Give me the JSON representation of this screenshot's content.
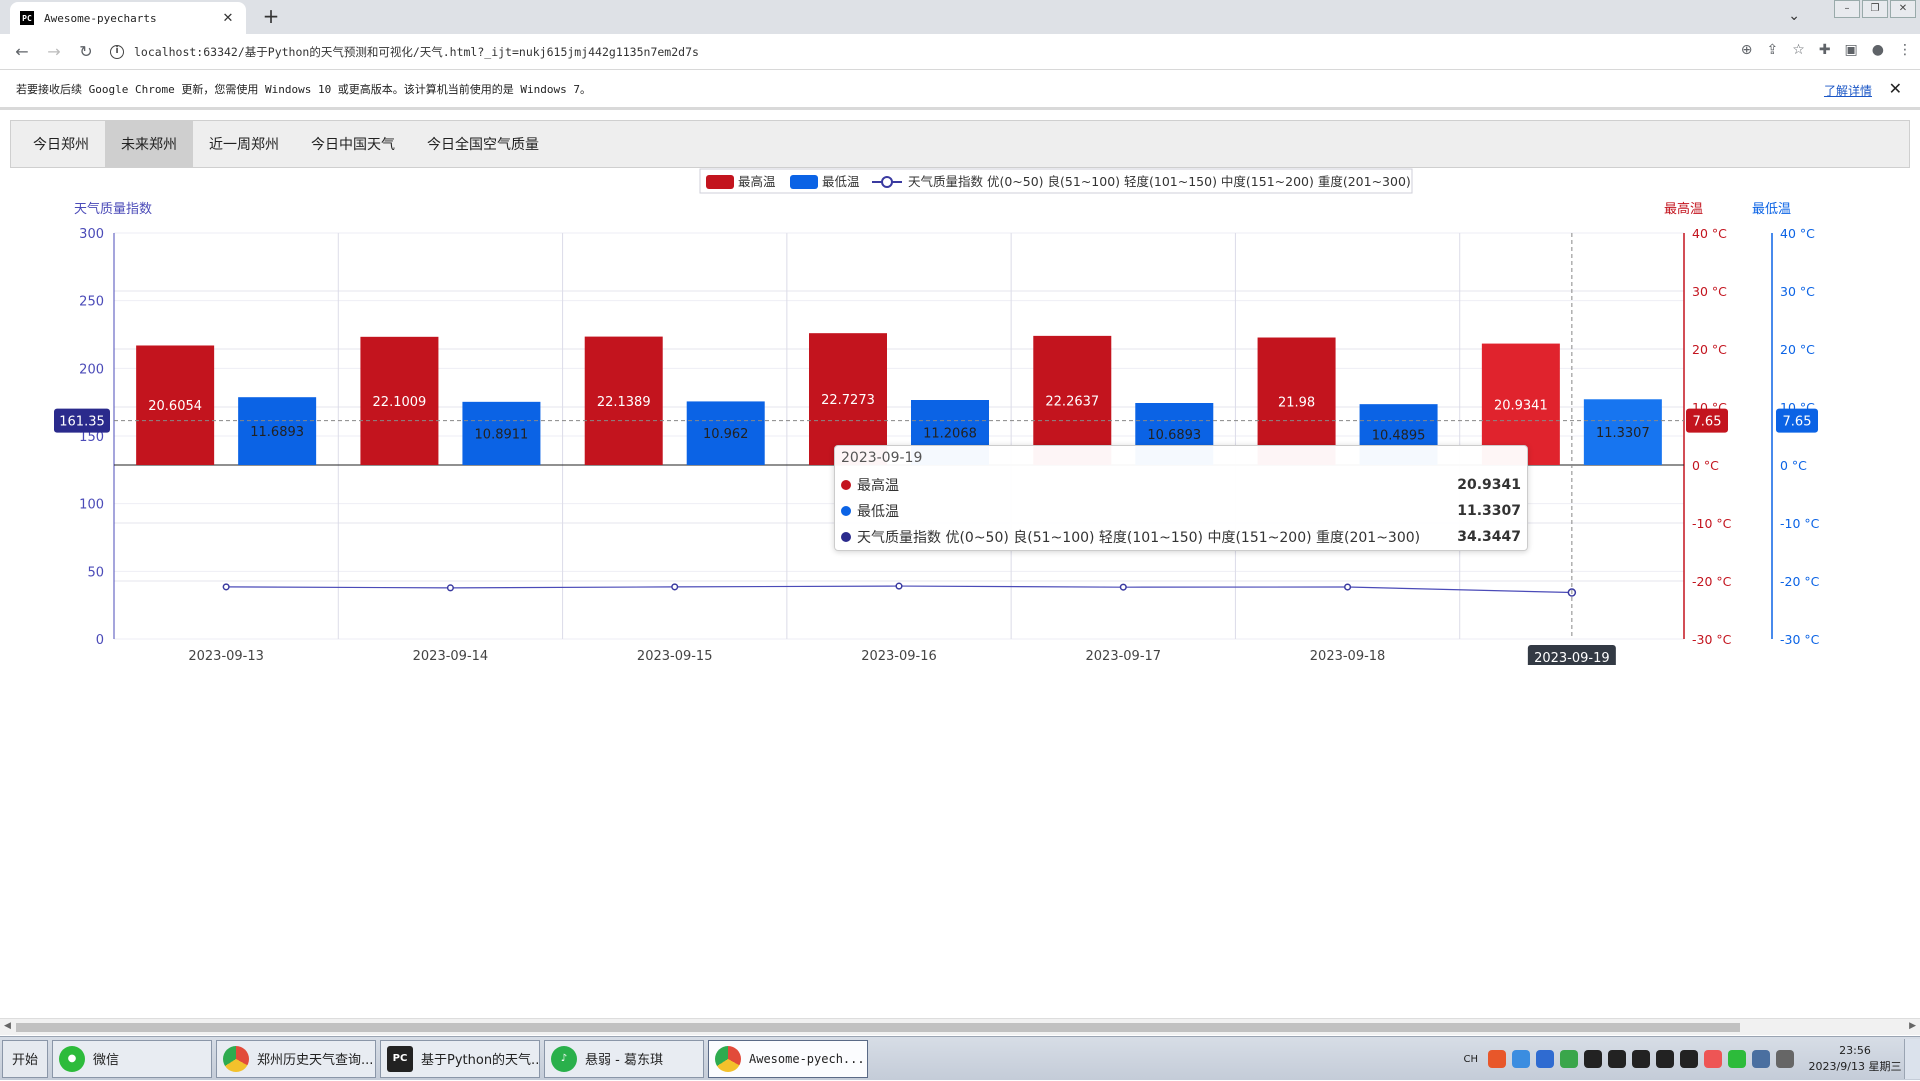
{
  "browser": {
    "tab_title": "Awesome-pyecharts",
    "tab_favicon": "PC",
    "url": "localhost:63342/基于Python的天气预测和可视化/天气.html?_ijt=nukj615jmj442g1135n7em2d7s",
    "infobar_message": "若要接收后续 Google Chrome 更新，您需使用 Windows 10 或更高版本。该计算机当前使用的是 Windows 7。",
    "infobar_link": "了解详情"
  },
  "page_tabs": [
    {
      "label": "今日郑州",
      "active": false
    },
    {
      "label": "未来郑州",
      "active": true
    },
    {
      "label": "近一周郑州",
      "active": false
    },
    {
      "label": "今日中国天气",
      "active": false
    },
    {
      "label": "今日全国空气质量",
      "active": false
    }
  ],
  "chart_data": {
    "type": "bar",
    "categories": [
      "2023-09-13",
      "2023-09-14",
      "2023-09-15",
      "2023-09-16",
      "2023-09-17",
      "2023-09-18",
      "2023-09-19"
    ],
    "series": [
      {
        "name": "最高温",
        "type": "bar",
        "axis": "最高温",
        "color": "#c3141e",
        "values": [
          20.6054,
          22.1009,
          22.1389,
          22.7273,
          22.2637,
          21.98,
          20.9341
        ]
      },
      {
        "name": "最低温",
        "type": "bar",
        "axis": "最低温",
        "color": "#0b63e5",
        "values": [
          11.6893,
          10.8911,
          10.962,
          11.2068,
          10.6893,
          10.4895,
          11.3307
        ]
      },
      {
        "name": "天气质量指数 优(0~50) 良(51~100) 轻度(101~150) 中度(151~200) 重度(201~300)",
        "type": "line",
        "axis": "天气质量指数",
        "color": "#3a3aa0",
        "values": [
          38.5,
          37.8,
          38.5,
          39.1,
          38.3,
          38.4,
          34.3447
        ]
      }
    ],
    "axes": {
      "aqi": {
        "label": "天气质量指数",
        "min": 0,
        "max": 300,
        "ticks": [
          "0",
          "50",
          "100",
          "150",
          "200",
          "250",
          "300"
        ],
        "color": "#4b4bb8"
      },
      "tmax": {
        "label": "最高温",
        "min": -30,
        "max": 40,
        "ticks": [
          "-30 °C",
          "-20 °C",
          "-10 °C",
          "0 °C",
          "10 °C",
          "20 °C",
          "30 °C",
          "40 °C"
        ],
        "color": "#c3141e"
      },
      "tmin": {
        "label": "最低温",
        "min": -30,
        "max": 40,
        "ticks": [
          "-30 °C",
          "-20 °C",
          "-10 °C",
          "0 °C",
          "10 °C",
          "20 °C",
          "30 °C",
          "40 °C"
        ],
        "color": "#0b63e5"
      }
    },
    "legend_position": "top-center",
    "crosshair": {
      "category": "2023-09-19",
      "aqi_label": "161.35",
      "tmax_label": "7.65",
      "tmin_label": "7.65"
    },
    "tooltip": {
      "date": "2023-09-19",
      "rows": [
        {
          "name": "最高温",
          "value": "20.9341",
          "color": "#c3141e"
        },
        {
          "name": "最低温",
          "value": "11.3307",
          "color": "#0b63e5"
        },
        {
          "name": "天气质量指数 优(0~50) 良(51~100) 轻度(101~150) 中度(151~200) 重度(201~300)",
          "value": "34.3447",
          "color": "#2a2a8c"
        }
      ]
    }
  },
  "taskbar": {
    "start_label": "开始",
    "tasks": [
      {
        "label": "微信",
        "icon": "wechat-icon",
        "color": "#2dbb3b"
      },
      {
        "label": "郑州历史天气查询...",
        "icon": "chrome-icon",
        "color": "#e24b3a"
      },
      {
        "label": "基于Python的天气...",
        "icon": "pycharm-icon",
        "color": "#222222"
      },
      {
        "label": "悬弱 - 葛东琪",
        "icon": "music-icon",
        "color": "#2ab04b"
      },
      {
        "label": "Awesome-pyech...",
        "icon": "chrome-icon",
        "color": "#e24b3a",
        "active": true
      }
    ],
    "input_lang": "CH",
    "clock_time": "23:56",
    "clock_date": "2023/9/13 星期三"
  }
}
